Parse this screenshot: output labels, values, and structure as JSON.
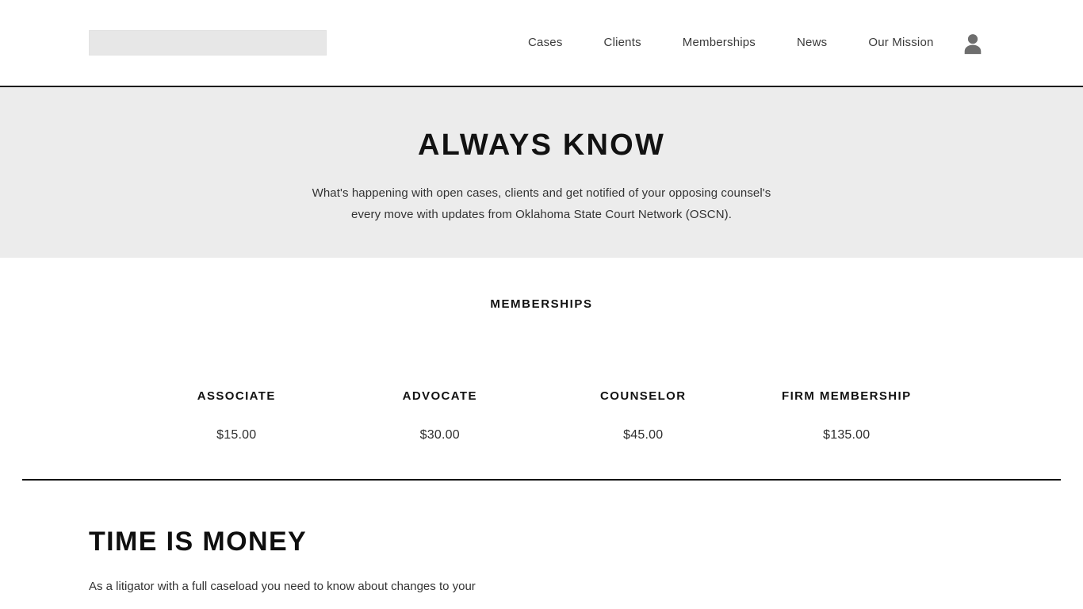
{
  "header": {
    "logo_alt": "",
    "nav": [
      {
        "label": "Cases"
      },
      {
        "label": "Clients"
      },
      {
        "label": "Memberships"
      },
      {
        "label": "News"
      },
      {
        "label": "Our Mission"
      }
    ],
    "account_icon": "user-icon"
  },
  "hero": {
    "title": "ALWAYS KNOW",
    "subtitle_line1": "What's happening with open cases, clients and get notified of your opposing counsel's",
    "subtitle_line2": "every move with updates from Oklahoma State Court Network (OSCN).",
    "background": "#ececec"
  },
  "memberships": {
    "heading": "MEMBERSHIPS",
    "tiers": [
      {
        "name": "ASSOCIATE",
        "price": "$15.00"
      },
      {
        "name": "ADVOCATE",
        "price": "$30.00"
      },
      {
        "name": "COUNSELOR",
        "price": "$45.00"
      },
      {
        "name": "FIRM MEMBERSHIP",
        "price": "$135.00"
      }
    ]
  },
  "time_section": {
    "title": "TIME IS MONEY",
    "body_line1": "As a litigator with a full caseload you need to know about changes to your"
  },
  "colors": {
    "page_background": "#ffffff",
    "band_background": "#ececec",
    "rule": "#141414",
    "text": "#333333",
    "heading": "#121212"
  }
}
